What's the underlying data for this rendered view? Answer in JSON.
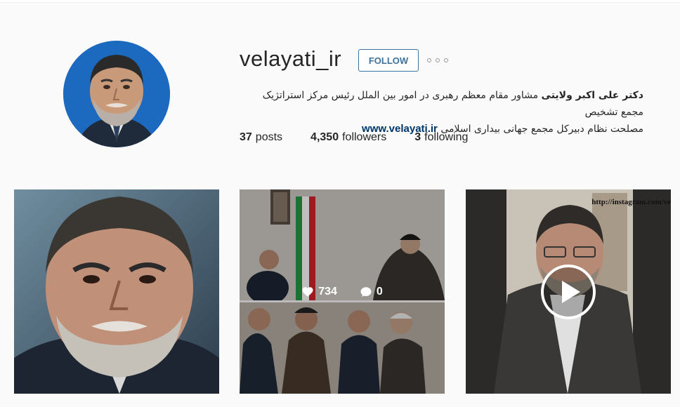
{
  "profile": {
    "username": "velayati_ir",
    "follow_label": "FOLLOW",
    "full_name": "دکتر علی اکبر ولایتی",
    "bio_line1": "مشاور مقام معظم رهبری در امور بین الملل رئیس مرکز استراتژیک مجمع تشخیص",
    "bio_line2": "مصلحت نظام دبیرکل مجمع جهانی بیداری اسلامی",
    "website": "www.velayati.ir"
  },
  "stats": {
    "posts_count": "37",
    "posts_label": "posts",
    "followers_count": "4,350",
    "followers_label": "followers",
    "following_count": "3",
    "following_label": "following"
  },
  "posts": [
    {
      "type": "photo"
    },
    {
      "type": "photo",
      "likes": "734",
      "comments": "0"
    },
    {
      "type": "video",
      "watermark": "http://instagram.com/ve"
    }
  ],
  "colors": {
    "follow_blue": "#3f729b",
    "link_blue": "#003569",
    "background": "#fafafa"
  }
}
